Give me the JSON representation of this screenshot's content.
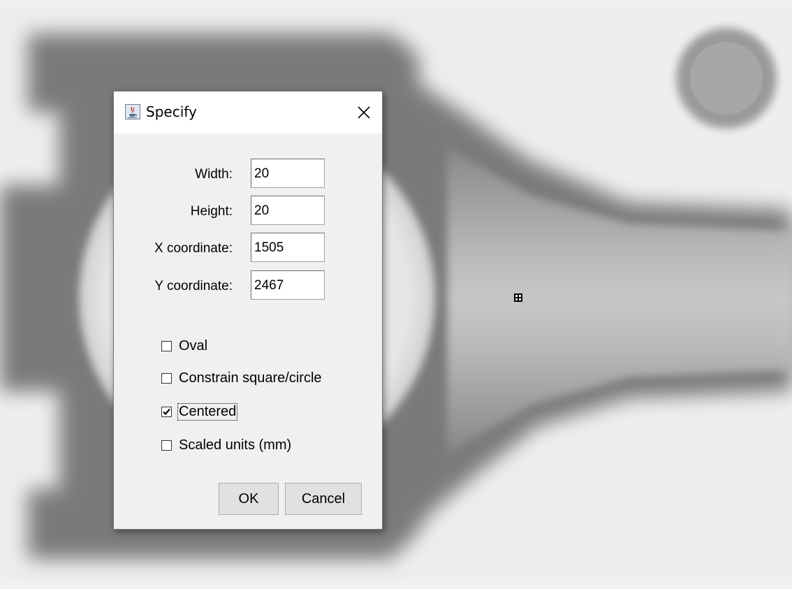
{
  "dialog": {
    "title": "Specify",
    "icon": "java-cup-icon",
    "close_icon": "close-icon"
  },
  "fields": {
    "width": {
      "label": "Width:",
      "value": "20"
    },
    "height": {
      "label": "Height:",
      "value": "20"
    },
    "x": {
      "label": "X coordinate:",
      "value": "1505"
    },
    "y": {
      "label": "Y coordinate:",
      "value": "2467"
    }
  },
  "options": {
    "oval": {
      "label": "Oval",
      "checked": false
    },
    "constrain": {
      "label": "Constrain square/circle",
      "checked": false
    },
    "centered": {
      "label": "Centered",
      "checked": true
    },
    "scaled": {
      "label": "Scaled units (mm)",
      "checked": false
    }
  },
  "buttons": {
    "ok": "OK",
    "cancel": "Cancel"
  }
}
